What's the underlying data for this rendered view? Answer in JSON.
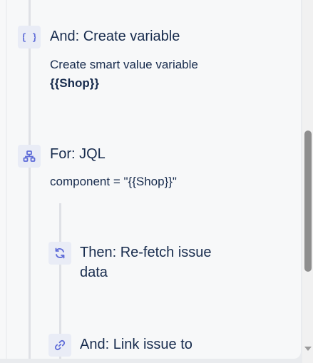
{
  "steps": [
    {
      "icon": "braces-icon",
      "title": "And: Create variable",
      "description": "Create smart value variable",
      "value": "{{Shop}}"
    },
    {
      "icon": "hierarchy-icon",
      "title": "For: JQL",
      "description": "component = \"{{Shop}}\""
    },
    {
      "icon": "refresh-icon",
      "title_line1": "Then: Re-fetch issue",
      "title_line2": "data"
    },
    {
      "icon": "link-icon",
      "title": "And: Link issue to"
    }
  ],
  "colors": {
    "icon_bg": "#e9ecf6",
    "icon_fg": "#5e6bd8",
    "text": "#172b4d",
    "rail": "#dfe1e6"
  }
}
